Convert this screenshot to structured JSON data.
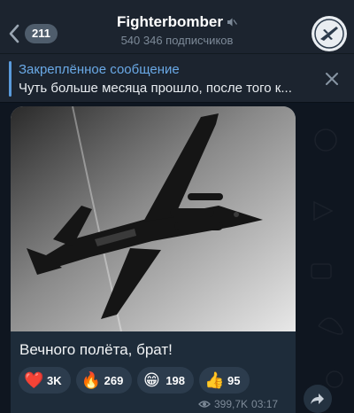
{
  "header": {
    "back_count": "211",
    "title": "Fighterbomber",
    "subtitle": "540 346 подписчиков",
    "muted": true
  },
  "pinned": {
    "title": "Закреплённое сообщение",
    "text": "Чуть больше месяца прошло, после того к..."
  },
  "message": {
    "caption": "Вечного полёта, брат!",
    "reactions": [
      {
        "emoji": "❤️",
        "count": "3K"
      },
      {
        "emoji": "🔥",
        "count": "269"
      },
      {
        "emoji": "😁",
        "count": "198"
      },
      {
        "emoji": "👍",
        "count": "95"
      }
    ],
    "views": "399,7K",
    "time": "03:17"
  },
  "colors": {
    "accent": "#6aa9e6",
    "header_bg": "#1c242f",
    "bubble_bg": "#1e2c3a",
    "chat_bg": "#0e1621"
  },
  "icons": {
    "back": "chevron-left-icon",
    "mute": "speaker-muted-icon",
    "close": "close-icon",
    "views": "eye-icon",
    "share": "share-arrow-icon"
  }
}
